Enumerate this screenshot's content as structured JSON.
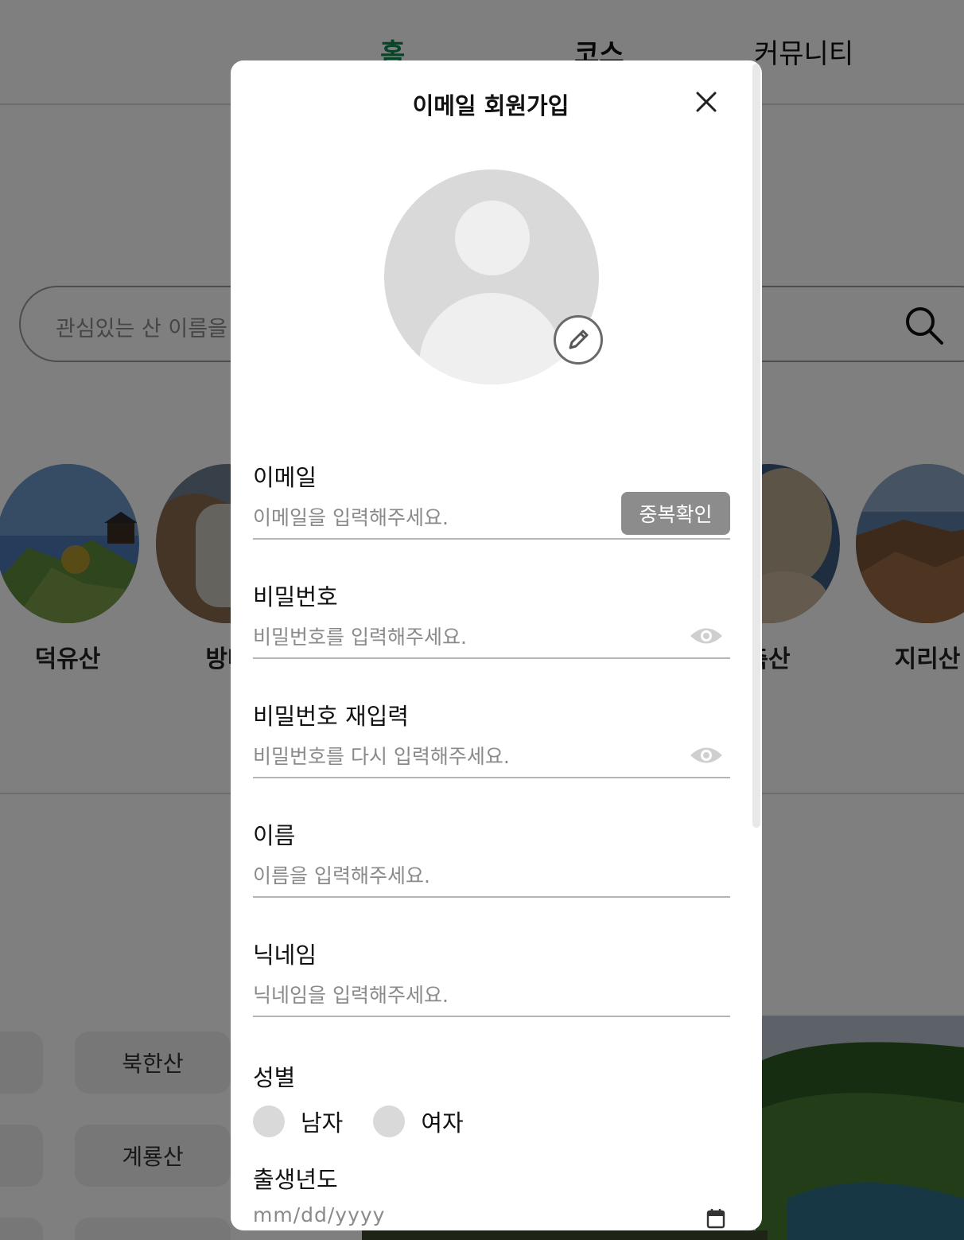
{
  "nav": {
    "home": "홈",
    "course": "코스",
    "community": "커뮤니티",
    "active_color": "#0f8a52"
  },
  "search": {
    "placeholder": "관심있는 산 이름을"
  },
  "mountains": [
    {
      "name": "덕유산"
    },
    {
      "name": "방태"
    },
    {
      "name": "축산"
    },
    {
      "name": "지리산"
    }
  ],
  "chips": [
    {
      "label": "북한산"
    },
    {
      "label": "계룡산"
    }
  ],
  "modal": {
    "title": "이메일 회원가입",
    "close_icon": "close-icon",
    "avatar_edit_icon": "pencil-icon",
    "email": {
      "label": "이메일",
      "placeholder": "이메일을 입력해주세요.",
      "dup_button": "중복확인"
    },
    "password": {
      "label": "비밀번호",
      "placeholder": "비밀번호를 입력해주세요."
    },
    "password_confirm": {
      "label": "비밀번호 재입력",
      "placeholder": "비밀번호를 다시 입력해주세요."
    },
    "name": {
      "label": "이름",
      "placeholder": "이름을 입력해주세요."
    },
    "nickname": {
      "label": "닉네임",
      "placeholder": "닉네임을 입력해주세요."
    },
    "gender": {
      "label": "성별",
      "male": "남자",
      "female": "여자"
    },
    "birth": {
      "label": "출생년도",
      "placeholder": "mm/dd/yyyy"
    }
  }
}
